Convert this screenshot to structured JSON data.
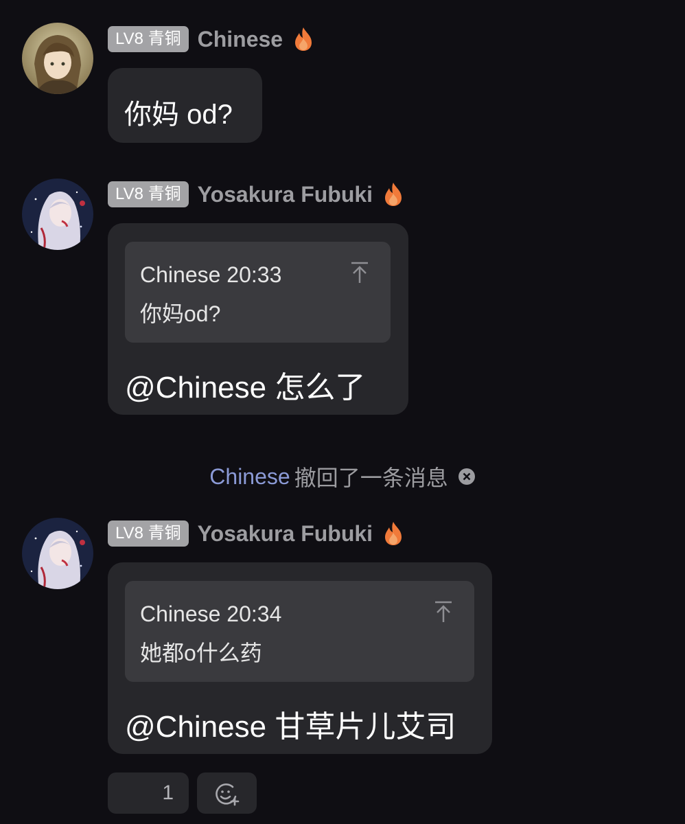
{
  "messages": [
    {
      "level": "LV8 青铜",
      "nickname": "Chinese",
      "text": "你妈 od?"
    },
    {
      "level": "LV8 青铜",
      "nickname": "Yosakura Fubuki",
      "quote": {
        "meta": "Chinese 20:33",
        "text": "你妈od?"
      },
      "text": "@Chinese 怎么了"
    },
    {
      "level": "LV8 青铜",
      "nickname": "Yosakura Fubuki",
      "quote": {
        "meta": "Chinese 20:34",
        "text": "她都o什么药"
      },
      "text": "@Chinese 甘草片儿艾司"
    }
  ],
  "recall_notice": {
    "user": "Chinese",
    "text": "撤回了一条消息"
  },
  "reactions": {
    "count": "1"
  },
  "colors": {
    "background": "#0f0e13",
    "bubble": "#27272b",
    "quote": "#3a3a3e",
    "badge": "#a3a3a6",
    "nickname": "#9d9da1",
    "recall_user": "#8b9ad6",
    "fire": "#f07a3a"
  },
  "icons": {
    "level_badge": "badge",
    "streak": "fire-icon",
    "jump_to_quote": "arrow-up-to-top-icon",
    "dismiss": "close-circle-icon",
    "add_reaction": "add-emoji-icon"
  }
}
